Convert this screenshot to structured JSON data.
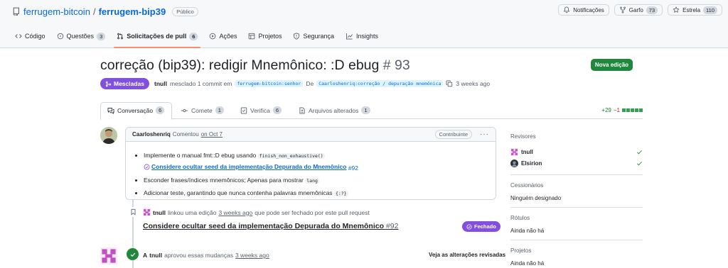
{
  "repo": {
    "owner": "ferrugem-bitcoin",
    "separator": "/",
    "name": "ferrugem-bip39",
    "visibility": "Público"
  },
  "repo_actions": [
    {
      "label": "Notificações",
      "icon": "bell-icon"
    },
    {
      "label": "Garfo",
      "count": "73",
      "icon": "fork-icon"
    },
    {
      "label": "Estrela",
      "count": "110",
      "icon": "star-icon"
    }
  ],
  "nav_tabs": [
    {
      "label": "Código",
      "icon": "code-icon"
    },
    {
      "label": "Questões",
      "count": "3",
      "icon": "issue-icon"
    },
    {
      "label": "Solicitações de pull",
      "count": "6",
      "icon": "pull-request-icon",
      "selected": true
    },
    {
      "label": "Ações",
      "icon": "play-icon"
    },
    {
      "label": "Projetos",
      "icon": "table-icon"
    },
    {
      "label": "Segurança",
      "icon": "shield-icon"
    },
    {
      "label": "Insights",
      "icon": "graph-icon"
    }
  ],
  "pr": {
    "title": "correção (bip39): redigir Mnemônico: :D ebug",
    "number": "# 93",
    "new_button": "Nova edição",
    "state": "Mescladas",
    "author": "tnull",
    "merged_text": "mesclado 1 commit em",
    "base_branch": "ferrugem-bitcoin:senhor",
    "from_text": "De",
    "head_branch": "Caarloshenriq:correção / depuração mnemônica",
    "time": "3 weeks ago"
  },
  "pr_tabs": [
    {
      "label": "Conversação",
      "count": "6",
      "icon": "conversation-icon"
    },
    {
      "label": "Comete",
      "count": "1",
      "icon": "commit-icon"
    },
    {
      "label": "Verifica",
      "count": "6",
      "icon": "checks-icon"
    },
    {
      "label": "Arquivos alterados",
      "count": "1",
      "icon": "file-diff-icon"
    }
  ],
  "diffstat": {
    "additions": "+29",
    "deletions": "−1"
  },
  "comment": {
    "author": "Caarloshenriq",
    "action": "Comentou",
    "when": "on Oct 7",
    "role": "Contribuinte",
    "item1_text": "Implemente o manual fmt::D ebug usando",
    "item1_code": "finish_non_exhaustive()",
    "item1_link": "Considere ocultar seed da implementação Depurada do Mnemônico",
    "item1_ref": "#92",
    "item2_text": "Esconder frases/índices mnemônicos; Apenas para mostrar",
    "item2_code": "lang",
    "item3_text": "Adicionar teste, garantindo que nunca contenha palavras mnemônicas",
    "item3_code": "{:?}"
  },
  "timeline_link": {
    "actor": "tnull",
    "text": "linkou uma edição",
    "time": "3 weeks ago",
    "rest": "que pode ser fechado por este pull request",
    "issue_title": "Considere ocultar seed da implementação Depurada do Mnemônico",
    "issue_number": "#92",
    "issue_state": "Fechado"
  },
  "approval": {
    "prefix": "A",
    "actor": "tnull",
    "text": "aprovou essas mudanças",
    "time": "3 weeks ago",
    "link": "Veja as alterações revisadas"
  },
  "sidebar": {
    "reviewers_heading": "Revisores",
    "reviewers": [
      {
        "name": "tnull"
      },
      {
        "name": "Elsirion"
      }
    ],
    "assignees_heading": "Cessionários",
    "assignees_value": "Ninguém designado",
    "labels_heading": "Rótulos",
    "labels_value": "Ainda não há",
    "projects_heading": "Projetos",
    "projects_value": "Ainda não há"
  },
  "colors": {
    "accent": "#0969da",
    "merged": "#8250df",
    "success": "#1f883d",
    "tab_underline": "#fd8c73"
  }
}
